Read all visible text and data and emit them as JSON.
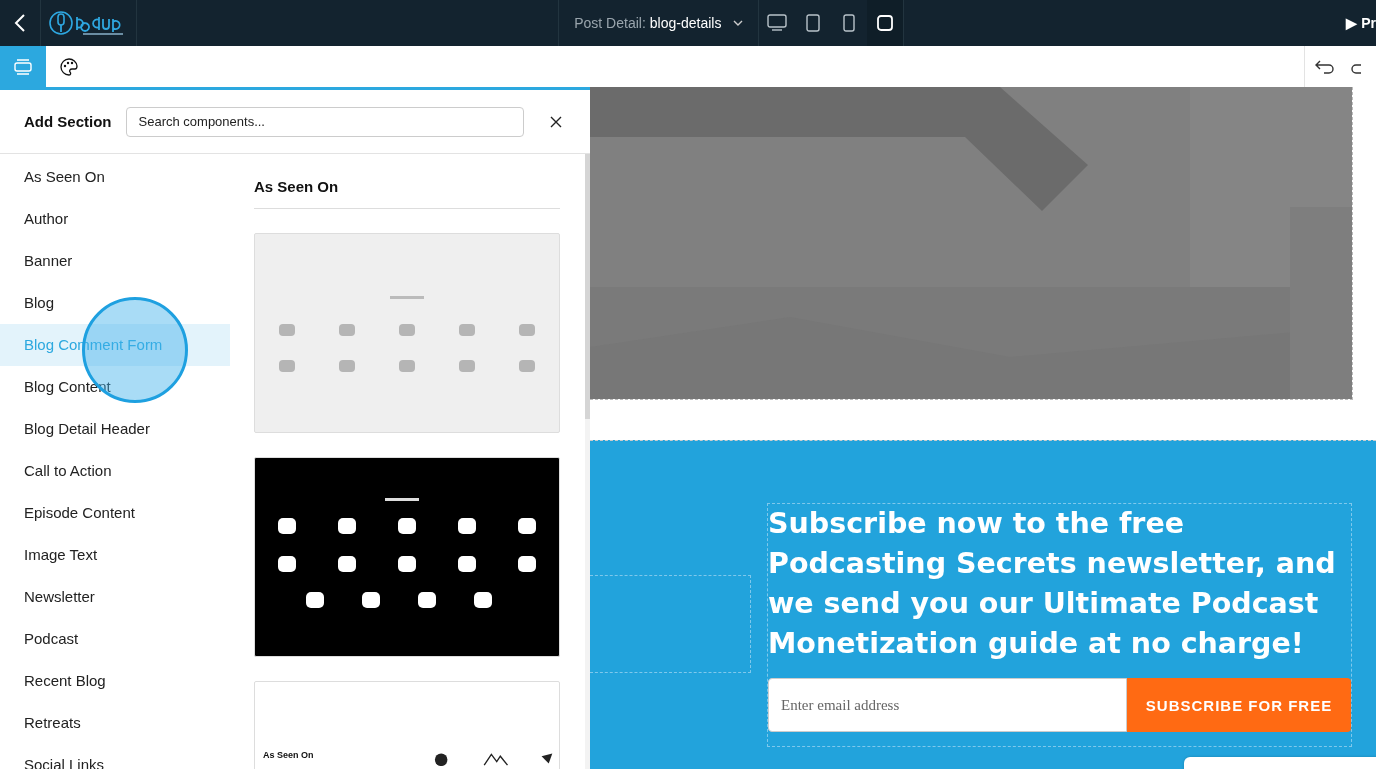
{
  "topbar": {
    "page_label": "Post Detail:",
    "page_value": "blog-details",
    "devices": [
      {
        "kind": "desktop",
        "selected": false
      },
      {
        "kind": "tablet",
        "selected": false
      },
      {
        "kind": "mobile",
        "selected": false
      },
      {
        "kind": "square",
        "selected": true
      }
    ],
    "preview": "▶ Pr"
  },
  "toolbar": {
    "tabs": [
      {
        "kind": "sections",
        "selected": true
      },
      {
        "kind": "theme",
        "selected": false
      }
    ]
  },
  "panel": {
    "title": "Add Section",
    "search": {
      "placeholder": "Search components..."
    },
    "categories": [
      {
        "label": "As Seen On",
        "selected": false
      },
      {
        "label": "Author",
        "selected": false
      },
      {
        "label": "Banner",
        "selected": false
      },
      {
        "label": "Blog",
        "selected": false
      },
      {
        "label": "Blog Comment Form",
        "selected": true
      },
      {
        "label": "Blog Content",
        "selected": false
      },
      {
        "label": "Blog Detail Header",
        "selected": false
      },
      {
        "label": "Call to Action",
        "selected": false
      },
      {
        "label": "Episode Content",
        "selected": false
      },
      {
        "label": "Image Text",
        "selected": false
      },
      {
        "label": "Newsletter",
        "selected": false
      },
      {
        "label": "Podcast",
        "selected": false
      },
      {
        "label": "Recent Blog",
        "selected": false
      },
      {
        "label": "Retreats",
        "selected": false
      },
      {
        "label": "Social Links",
        "selected": false
      }
    ],
    "group_title": "As Seen On",
    "templates": [
      {
        "kind": "light"
      },
      {
        "kind": "dark"
      },
      {
        "kind": "plain",
        "heading": "As Seen On"
      }
    ]
  },
  "canvas": {
    "headline": "Subscribe now to the free Podcasting Secrets newsletter, and we send you our Ultimate Podcast Monetization guide at no charge!",
    "email": {
      "placeholder": "Enter email address"
    },
    "button": "SUBSCRIBE FOR FREE"
  }
}
